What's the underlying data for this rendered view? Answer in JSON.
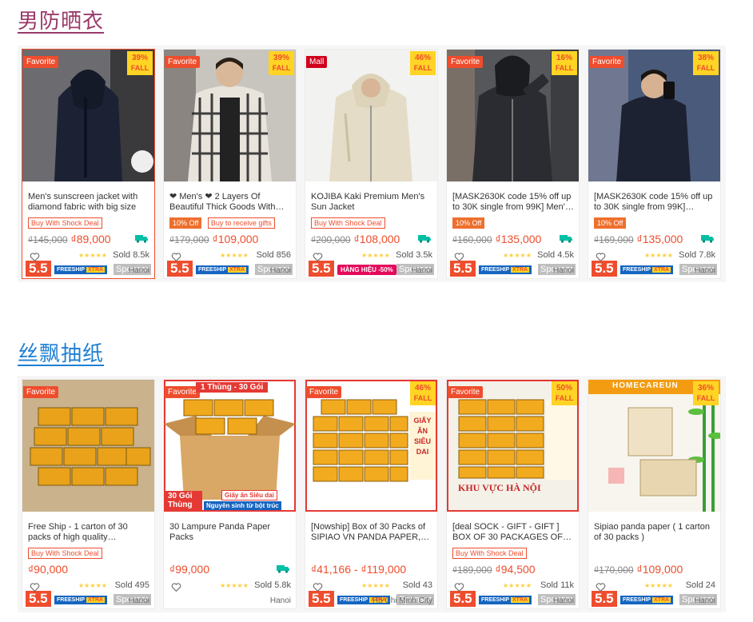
{
  "sections": [
    {
      "title": "男防晒衣",
      "products": [
        {
          "tag": "Favorite",
          "discount": "39%",
          "disc_label": "FALL",
          "name": "Men's sunscreen jacket with diamond fabric with big size x…",
          "badges": [
            "Buy With Shock Deal"
          ],
          "old_price": "₫145,000",
          "price": "₫89,000",
          "free_ship": true,
          "sold": "Sold 8.5k",
          "location": "Hanoi"
        },
        {
          "tag": "Favorite",
          "discount": "39%",
          "disc_label": "FALL",
          "name": "❤ Men's ❤ 2 Layers Of Beautiful Thick Goods With…",
          "badges": [
            "10% Off",
            "Buy to receive gifts"
          ],
          "old_price": "₫179,000",
          "price": "₫109,000",
          "free_ship": false,
          "sold": "Sold 856",
          "location": "Hanoi"
        },
        {
          "tag": "Mall",
          "discount": "46%",
          "disc_label": "FALL",
          "name": "KOJIBA Kaki Premium Men's Sun Jacket",
          "badges": [
            "Buy With Shock Deal"
          ],
          "old_price": "₫200,000",
          "price": "₫108,000",
          "free_ship": true,
          "sold": "Sold 3.5k",
          "location": "Hanoi"
        },
        {
          "tag": "Favorite",
          "discount": "16%",
          "disc_label": "FALL",
          "name": "[MASK2630K code 15% off up to 30K single from 99K] Men'…",
          "badges": [
            "10% Off"
          ],
          "old_price": "₫160,000",
          "price": "₫135,000",
          "free_ship": true,
          "sold": "Sold 4.5k",
          "location": "Hanoi"
        },
        {
          "tag": "Favorite",
          "discount": "38%",
          "disc_label": "FALL",
          "name": "[MASK2630K code 15% off up to 30K single from 99K]…",
          "badges": [
            "10% Off"
          ],
          "old_price": "₫169,000",
          "price": "₫135,000",
          "free_ship": true,
          "sold": "Sold 7.8k",
          "location": "Hanoi"
        }
      ]
    },
    {
      "title": "丝飘抽纸",
      "products": [
        {
          "tag": "Favorite",
          "discount": "",
          "disc_label": "",
          "name": "Free Ship - 1 carton of 30 packs of high quality…",
          "badges": [
            "Buy With Shock Deal"
          ],
          "old_price": "",
          "price": "₫90,000",
          "free_ship": false,
          "sold": "Sold 495",
          "location": "Hanoi"
        },
        {
          "tag": "Favorite",
          "discount": "",
          "disc_label": "",
          "name": "30 Lampure Panda Paper Packs",
          "badges": [],
          "old_price": "",
          "price": "₫99,000",
          "free_ship": true,
          "sold": "Sold 5.8k",
          "location": "Hanoi"
        },
        {
          "tag": "Favorite",
          "discount": "46%",
          "disc_label": "FALL",
          "name": "[Nowship] Box of 30 Packs of SIPIAO VN PANDA PAPER,…",
          "badges": [],
          "old_price": "",
          "price": "₫41,166 - ₫119,000",
          "free_ship": false,
          "sold": "Sold 43",
          "location": "Ho Chi Minh City"
        },
        {
          "tag": "Favorite",
          "discount": "50%",
          "disc_label": "FALL",
          "name": "[deal SOCK - GIFT - GIFT ] BOX OF 30 PACKAGES OF…",
          "badges": [
            "Buy With Shock Deal"
          ],
          "old_price": "₫189,000",
          "price": "₫94,500",
          "free_ship": false,
          "sold": "Sold 11k",
          "location": "Hanoi"
        },
        {
          "tag": "",
          "discount": "36%",
          "disc_label": "FALL",
          "name": "Sipiao panda paper ( 1 carton of 30 packs )",
          "badges": [],
          "old_price": "₫170,000",
          "price": "₫109,000",
          "free_ship": false,
          "sold": "Sold 24",
          "location": "Hanoi"
        }
      ]
    }
  ],
  "common": {
    "sponsor": "Sponsor",
    "promo": "5.5",
    "freeship": "FREESHIP",
    "xtra": "XTRA",
    "stars": "★★★★★"
  },
  "overlays": {
    "hang_hieu": "HÀNG HIỆU -50%",
    "thung_goi": "1 Thùng - 30 Gói",
    "thung_30": "30 Gói Thùng",
    "giay_an": "Giấy ăn Siêu dai",
    "nguyen_sinh": "Nguyên sinh từ bột trúc",
    "giay_an_sieu_dai": "GIẤY ĂN SIÊU DAI",
    "khu_vuc": "KHU VỰC HÀ NỘI",
    "homecare": "HOMECAREUN"
  },
  "colors": {
    "accent": "#ee4d2d",
    "title1": "#9b3a6a",
    "title2": "#1f7fd3",
    "star": "#ffce3d"
  }
}
